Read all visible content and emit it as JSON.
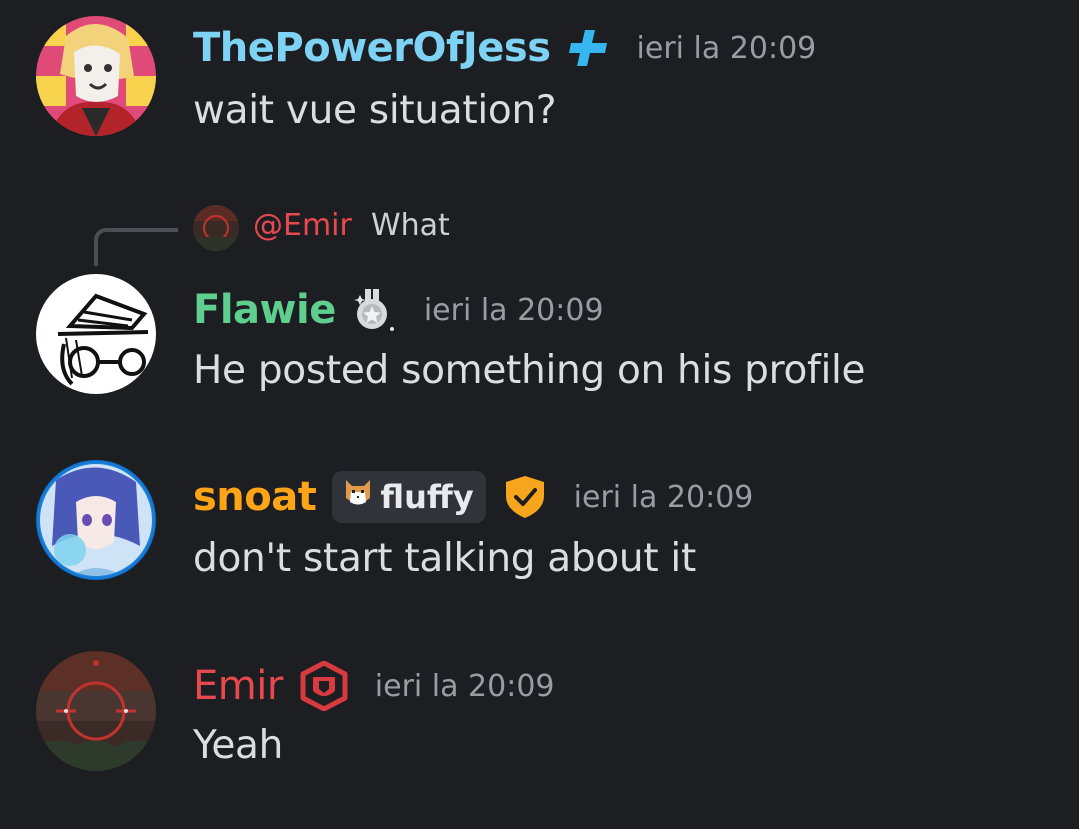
{
  "messages": [
    {
      "username": "ThePowerOfJess",
      "username_color": "#7ed3f5",
      "badge": "plus-icon",
      "timestamp": "ieri la 20:09",
      "text": "wait vue situation?"
    },
    {
      "reply": {
        "mention": "@Emir",
        "text": "What"
      },
      "username": "Flawie",
      "username_color": "#5fcf8f",
      "badge": "medal-icon",
      "timestamp": "ieri la 20:09",
      "text": "He posted something on his profile"
    },
    {
      "username": "snoat",
      "username_color": "#ffa417",
      "tag": "fluffy",
      "badge": "shield-check-icon",
      "timestamp": "ieri la 20:09",
      "text": "don't start talking about it"
    },
    {
      "username": "Emir",
      "username_color": "#e8494f",
      "badge": "hexagon-shield-icon",
      "timestamp": "ieri la 20:09",
      "text": "Yeah"
    }
  ]
}
